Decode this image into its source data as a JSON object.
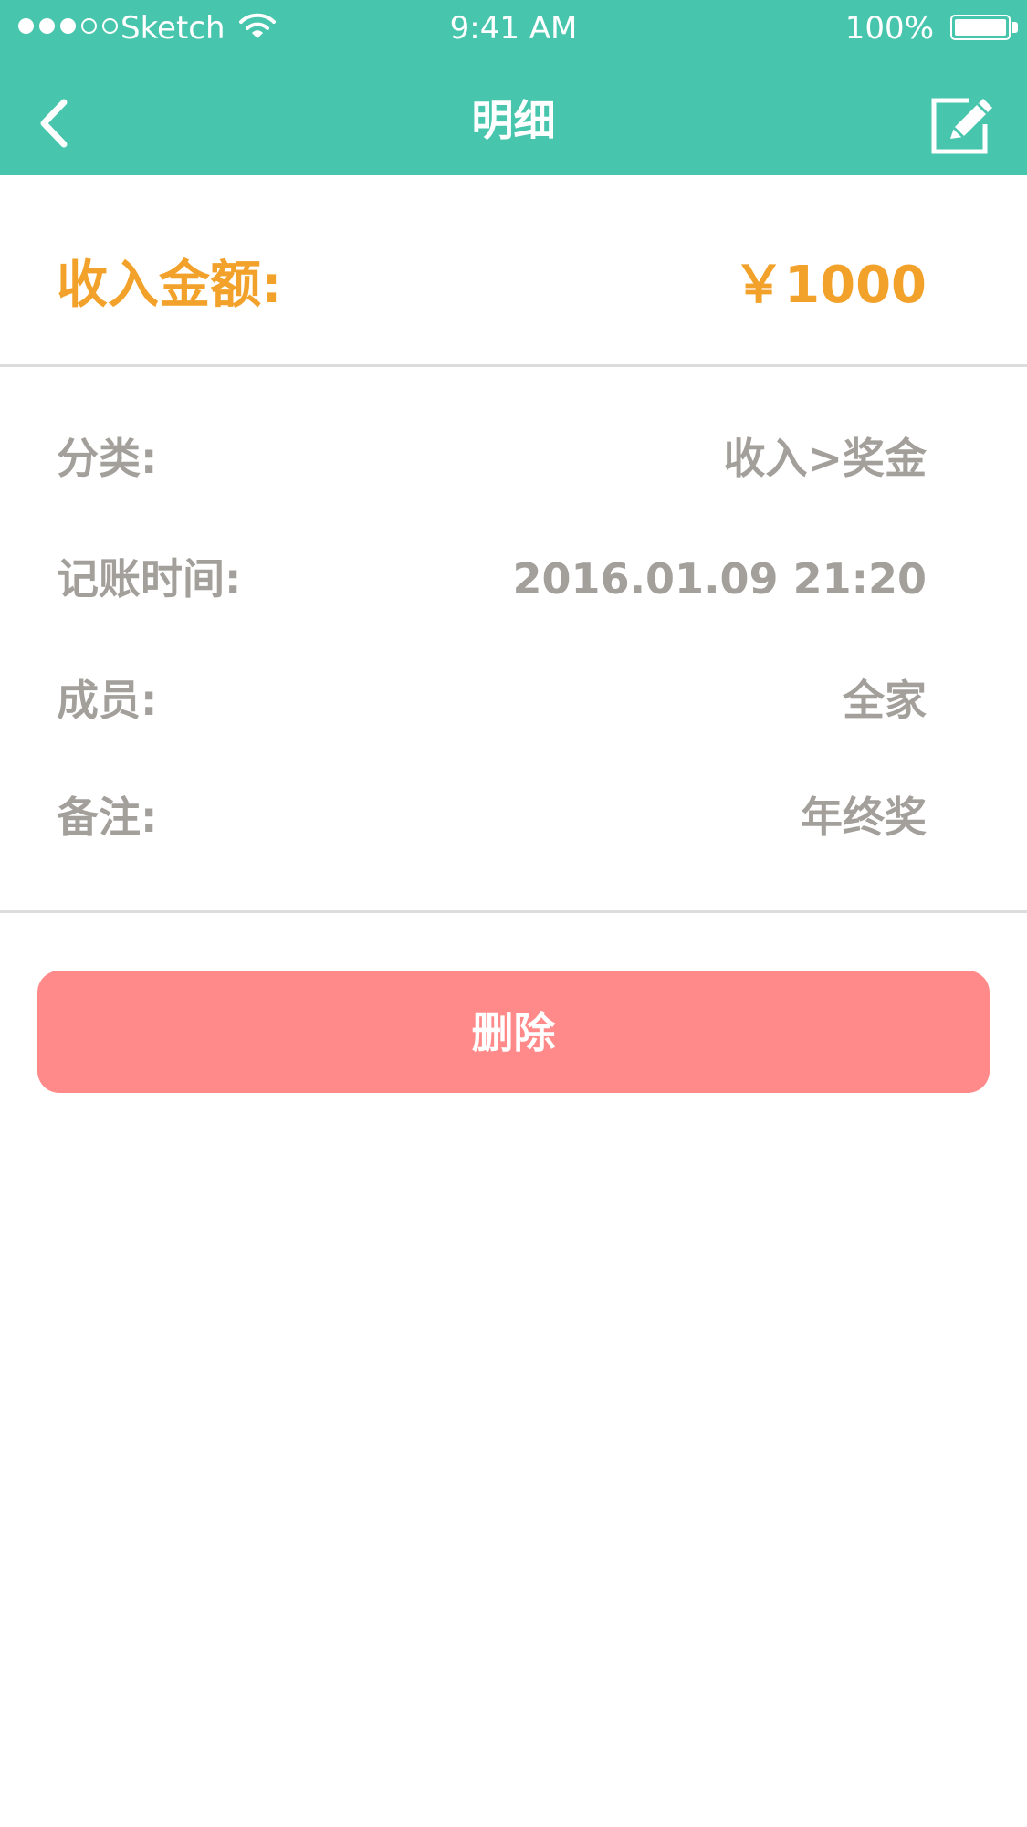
{
  "status_bar": {
    "carrier": "Sketch",
    "time": "9:41 AM",
    "battery": "100%",
    "signal_icon": "signal-dots-icon",
    "wifi_icon": "wifi-icon",
    "battery_icon": "battery-icon",
    "battery_level": 1.0
  },
  "header": {
    "title": "明细",
    "back_icon": "chevron-left-icon",
    "edit_icon": "edit-icon",
    "background_color": "#48c6ad"
  },
  "amount": {
    "label": "收入金额:",
    "value": "￥1000",
    "color": "#f2a22b"
  },
  "details": [
    {
      "label": "分类:",
      "value": "收入>奖金"
    },
    {
      "label": "记账时间:",
      "value": "2016.01.09 21:20"
    },
    {
      "label": "成员:",
      "value": "全家"
    },
    {
      "label": "备注:",
      "value": "年终奖"
    }
  ],
  "delete_button": {
    "label": "删除",
    "color": "#ff8a89"
  }
}
